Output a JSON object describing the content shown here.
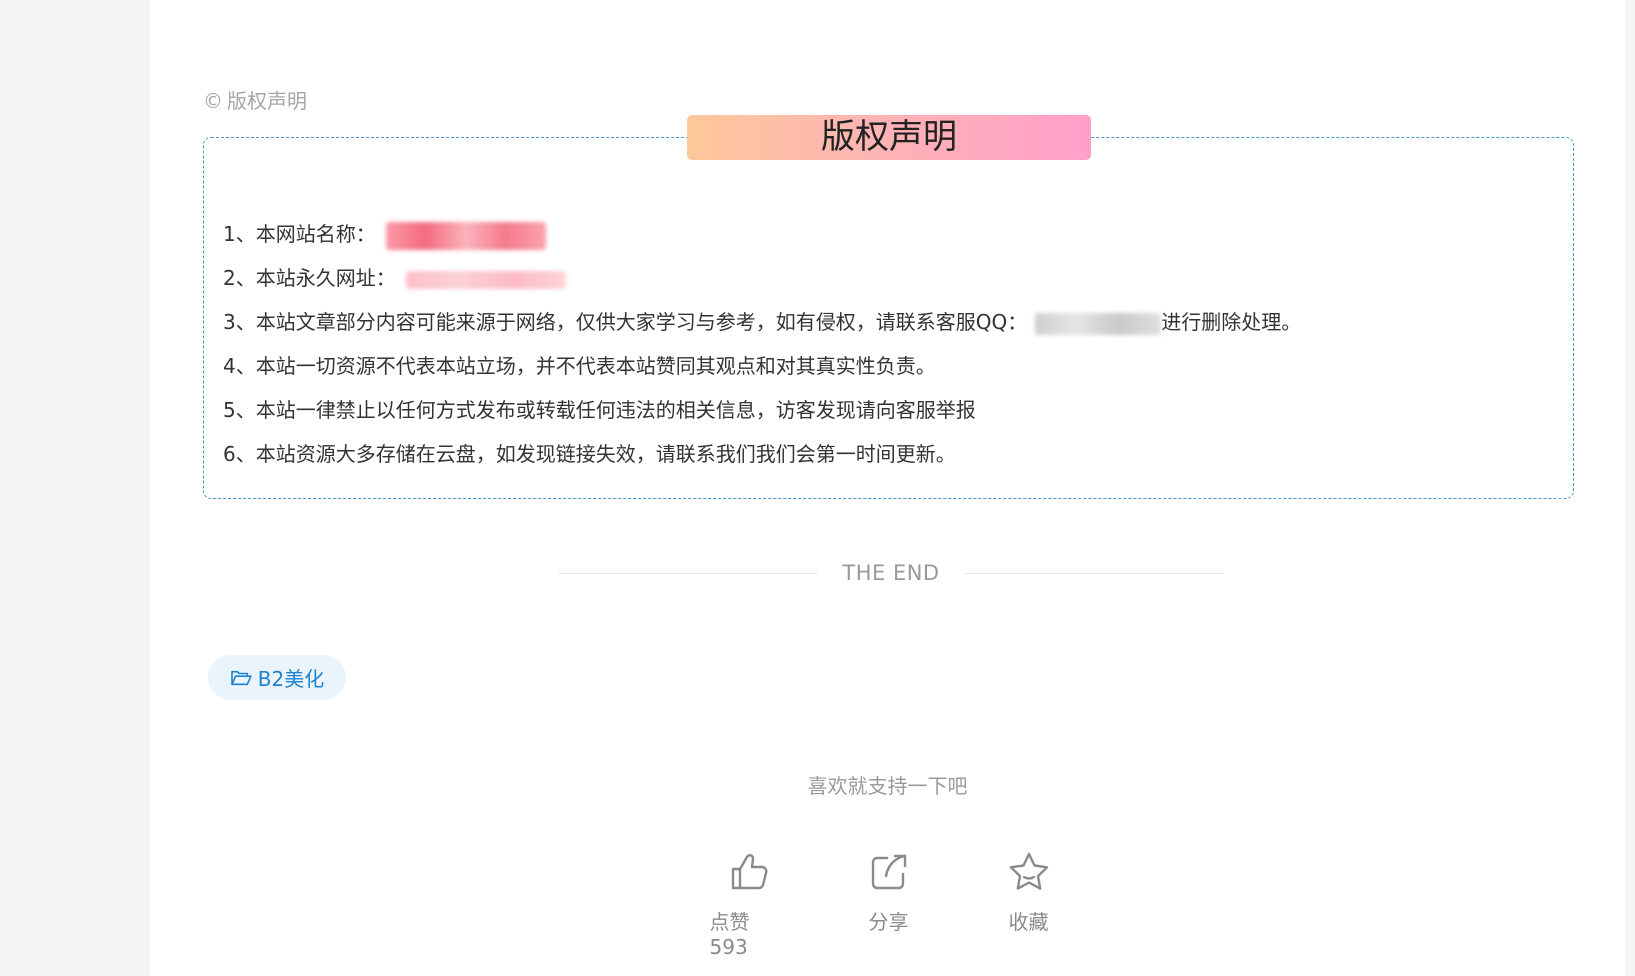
{
  "copyright_header": {
    "symbol": "©",
    "label": "版权声明"
  },
  "notice": {
    "title": "版权声明",
    "items": [
      {
        "text": "1、本网站名称：",
        "redacted": "site-name"
      },
      {
        "text": "2、本站永久网址：",
        "redacted": "site-url"
      },
      {
        "text": "3、本站文章部分内容可能来源于网络，仅供大家学习与参考，如有侵权，请联系客服QQ：",
        "redacted": "qq-number",
        "suffix": "进行删除处理。"
      },
      {
        "text": "4、本站一切资源不代表本站立场，并不代表本站赞同其观点和对其真实性负责。"
      },
      {
        "text": "5、本站一律禁止以任何方式发布或转载任何违法的相关信息，访客发现请向客服举报"
      },
      {
        "text": "6、本站资源大多存储在云盘，如发现链接失效，请联系我们我们会第一时间更新。"
      }
    ]
  },
  "divider": {
    "text": "THE END"
  },
  "tag": {
    "label": "B2美化",
    "icon": "folder-open-icon"
  },
  "support": {
    "text": "喜欢就支持一下吧"
  },
  "actions": [
    {
      "name": "like",
      "icon": "thumbs-up-icon",
      "label": "点赞 593"
    },
    {
      "name": "share",
      "icon": "share-icon",
      "label": "分享"
    },
    {
      "name": "favorite",
      "icon": "star-icon",
      "label": "收藏"
    }
  ],
  "colors": {
    "accent_blue": "#1f82cf",
    "notice_border": "#4a96c9",
    "title_gradient": [
      "#fdc89a",
      "#fdb5b3",
      "#ff9fca"
    ]
  }
}
